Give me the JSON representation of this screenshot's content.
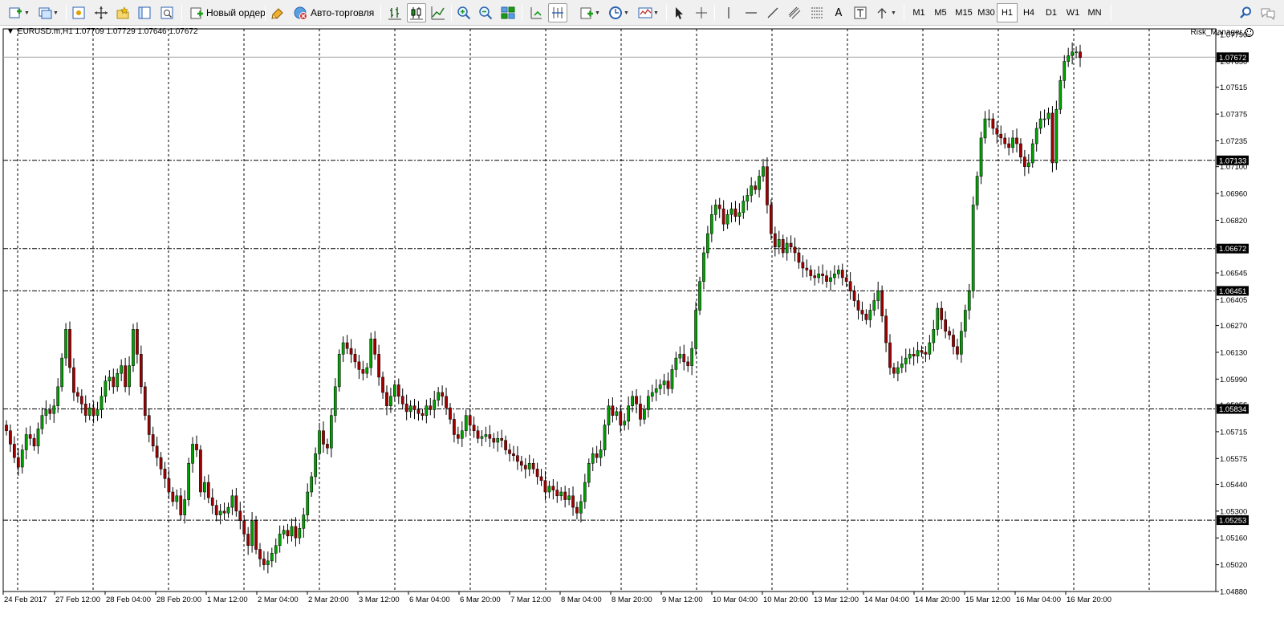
{
  "toolbar": {
    "new_order_label": "Новый ордер",
    "auto_trading_label": "Авто-торговля",
    "timeframes": [
      "M1",
      "M5",
      "M15",
      "M30",
      "H1",
      "H4",
      "D1",
      "W1",
      "MN"
    ],
    "active_timeframe": "H1"
  },
  "chart": {
    "symbol_line": "EURUSD.m,H1  1.07709 1.07729 1.07646 1.07672",
    "expert_name": "Risk_Manager",
    "current_price_label": "1.07672",
    "hline_labels": [
      "1.07133",
      "1.06672",
      "1.06451",
      "1.05834",
      "1.05253"
    ]
  },
  "colors": {
    "bull": "#00a000",
    "bear": "#a00000",
    "wick": "#000000",
    "grid": "#000000",
    "background": "#ffffff"
  },
  "chart_data": {
    "type": "candlestick",
    "ylim": [
      1.0488,
      1.0782
    ],
    "yticks": [
      "1.07790",
      "1.07650",
      "1.07515",
      "1.07375",
      "1.07235",
      "1.07100",
      "1.06960",
      "1.06820",
      "1.06680",
      "1.06545",
      "1.06405",
      "1.06270",
      "1.06130",
      "1.05990",
      "1.05855",
      "1.05715",
      "1.05575",
      "1.05440",
      "1.05300",
      "1.05160",
      "1.05020",
      "1.04880"
    ],
    "yticks_num": [
      1.0779,
      1.0765,
      1.07515,
      1.07375,
      1.07235,
      1.071,
      1.0696,
      1.0682,
      1.0668,
      1.06545,
      1.06405,
      1.0627,
      1.0613,
      1.0599,
      1.05855,
      1.05715,
      1.05575,
      1.0544,
      1.053,
      1.0516,
      1.0502,
      1.0488
    ],
    "xticks": [
      "24 Feb 2017",
      "27 Feb 12:00",
      "28 Feb 04:00",
      "28 Feb 20:00",
      "1 Mar 12:00",
      "2 Mar 04:00",
      "2 Mar 20:00",
      "3 Mar 12:00",
      "6 Mar 04:00",
      "6 Mar 20:00",
      "7 Mar 12:00",
      "8 Mar 04:00",
      "8 Mar 20:00",
      "9 Mar 12:00",
      "10 Mar 04:00",
      "10 Mar 20:00",
      "13 Mar 12:00",
      "14 Mar 04:00",
      "14 Mar 20:00",
      "15 Mar 12:00",
      "16 Mar 04:00",
      "16 Mar 20:00"
    ],
    "current_price": 1.07672,
    "hlines": [
      1.07133,
      1.06672,
      1.06451,
      1.05834,
      1.05253
    ],
    "closes": [
      1.0572,
      1.0565,
      1.0558,
      1.0553,
      1.0562,
      1.057,
      1.0568,
      1.0564,
      1.0573,
      1.058,
      1.0583,
      1.0581,
      1.0585,
      1.0595,
      1.061,
      1.0625,
      1.0605,
      1.0592,
      1.059,
      1.0586,
      1.058,
      1.0584,
      1.058,
      1.0583,
      1.059,
      1.0598,
      1.06,
      1.0595,
      1.0602,
      1.0606,
      1.0595,
      1.0606,
      1.0625,
      1.0612,
      1.0595,
      1.058,
      1.057,
      1.0564,
      1.0558,
      1.0552,
      1.0547,
      1.054,
      1.0535,
      1.0538,
      1.0528,
      1.0536,
      1.0555,
      1.0565,
      1.0562,
      1.054,
      1.0545,
      1.0537,
      1.0533,
      1.0528,
      1.053,
      1.0529,
      1.0532,
      1.0538,
      1.053,
      1.0525,
      1.0518,
      1.0512,
      1.0525,
      1.051,
      1.0505,
      1.0502,
      1.0504,
      1.0508,
      1.0512,
      1.0518,
      1.052,
      1.0517,
      1.0522,
      1.0516,
      1.0521,
      1.0528,
      1.054,
      1.0548,
      1.056,
      1.0572,
      1.0565,
      1.0563,
      1.058,
      1.0595,
      1.0612,
      1.0618,
      1.0615,
      1.0612,
      1.0608,
      1.0604,
      1.0602,
      1.0605,
      1.062,
      1.0612,
      1.06,
      1.0592,
      1.0585,
      1.059,
      1.0596,
      1.059,
      1.0586,
      1.0582,
      1.0585,
      1.0583,
      1.0581,
      1.058,
      1.0585,
      1.0583,
      1.0588,
      1.0592,
      1.059,
      1.0584,
      1.0578,
      1.057,
      1.0568,
      1.0572,
      1.058,
      1.0575,
      1.0572,
      1.0568,
      1.0569,
      1.057,
      1.0568,
      1.0566,
      1.0568,
      1.0567,
      1.0562,
      1.056,
      1.0559,
      1.0556,
      1.0554,
      1.0552,
      1.0555,
      1.0552,
      1.0548,
      1.0546,
      1.054,
      1.0543,
      1.0541,
      1.0538,
      1.054,
      1.0536,
      1.0538,
      1.0532,
      1.0529,
      1.0535,
      1.0545,
      1.0555,
      1.056,
      1.0558,
      1.0562,
      1.0575,
      1.0585,
      1.058,
      1.0582,
      1.0575,
      1.0577,
      1.0585,
      1.059,
      1.0586,
      1.0578,
      1.0583,
      1.059,
      1.0592,
      1.0594,
      1.0596,
      1.0598,
      1.0594,
      1.0604,
      1.061,
      1.0612,
      1.0608,
      1.0606,
      1.0615,
      1.0635,
      1.065,
      1.0665,
      1.0675,
      1.0685,
      1.069,
      1.0688,
      1.068,
      1.0685,
      1.0688,
      1.0684,
      1.0686,
      1.0692,
      1.0695,
      1.07,
      1.0698,
      1.0705,
      1.071,
      1.069,
      1.0675,
      1.0668,
      1.0672,
      1.0665,
      1.067,
      1.0668,
      1.0665,
      1.066,
      1.0657,
      1.0656,
      1.0653,
      1.0652,
      1.0654,
      1.0653,
      1.065,
      1.0652,
      1.0654,
      1.0656,
      1.0652,
      1.065,
      1.0645,
      1.064,
      1.0635,
      1.0633,
      1.063,
      1.0635,
      1.064,
      1.0645,
      1.0632,
      1.0618,
      1.0605,
      1.0602,
      1.0605,
      1.0607,
      1.061,
      1.0612,
      1.0611,
      1.0614,
      1.0613,
      1.0612,
      1.0618,
      1.0625,
      1.0636,
      1.063,
      1.0624,
      1.0622,
      1.0616,
      1.0612,
      1.0624,
      1.0635,
      1.0645,
      1.069,
      1.0705,
      1.0725,
      1.0735,
      1.0735,
      1.073,
      1.0727,
      1.0725,
      1.0722,
      1.072,
      1.0725,
      1.0722,
      1.0715,
      1.071,
      1.0712,
      1.0722,
      1.073,
      1.0735,
      1.0735,
      1.0738,
      1.0712,
      1.074,
      1.0755,
      1.0765,
      1.0768,
      1.077,
      1.077,
      1.0767
    ]
  }
}
